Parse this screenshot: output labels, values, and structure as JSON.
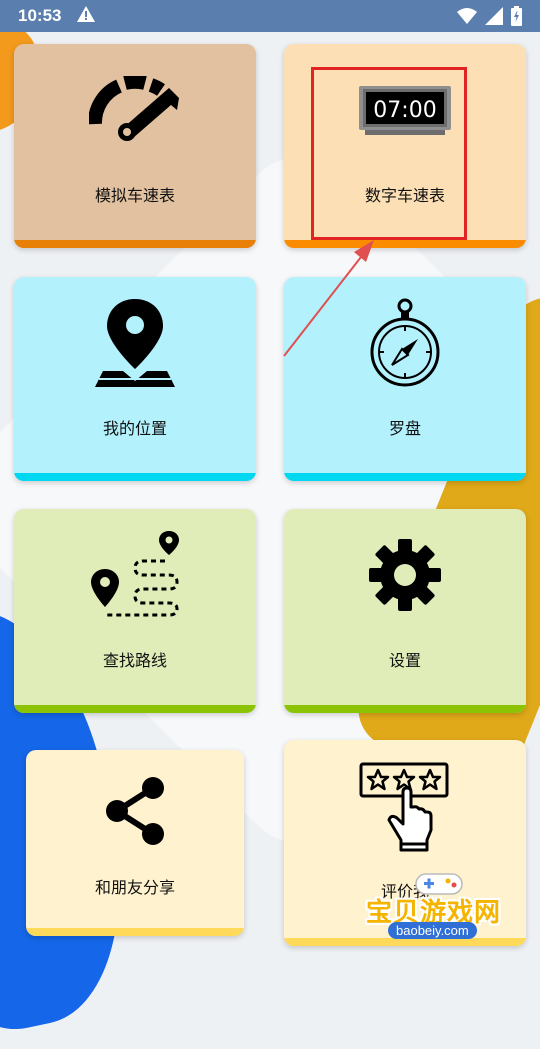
{
  "status_bar": {
    "time": "10:53",
    "warning_icon": "warning-triangle-icon",
    "wifi_icon": "wifi-icon",
    "signal_icon": "signal-icon",
    "battery_icon": "battery-icon"
  },
  "menu": {
    "items": [
      {
        "label": "模拟车速表",
        "icon": "analog-speedometer-icon",
        "bg": "#e1c19f",
        "accent": "#e88007"
      },
      {
        "label": "数字车速表",
        "icon": "digital-clock-icon",
        "display_text": "07:00",
        "bg": "#fddfb6",
        "accent": "#fb8c00"
      },
      {
        "label": "我的位置",
        "icon": "location-map-pin-icon",
        "bg": "#b3f1fd",
        "accent": "#00d7f0"
      },
      {
        "label": "罗盘",
        "icon": "compass-icon",
        "bg": "#b3f1fd",
        "accent": "#00d7f0"
      },
      {
        "label": "查找路线",
        "icon": "route-icon",
        "bg": "#e0edb8",
        "accent": "#8cc405"
      },
      {
        "label": "设置",
        "icon": "gear-icon",
        "bg": "#e0edb8",
        "accent": "#8cc405"
      },
      {
        "label": "和朋友分享",
        "icon": "share-icon",
        "bg": "#fff2cf",
        "accent": "#ffd95a"
      },
      {
        "label": "评价我",
        "icon": "rate-stars-hand-icon",
        "bg": "#fff2cf",
        "accent": "#ffd95a"
      }
    ]
  },
  "annotation": {
    "highlight_color": "#e02424"
  },
  "watermark": {
    "text": "宝贝游戏网",
    "url": "baobeiy.com"
  }
}
